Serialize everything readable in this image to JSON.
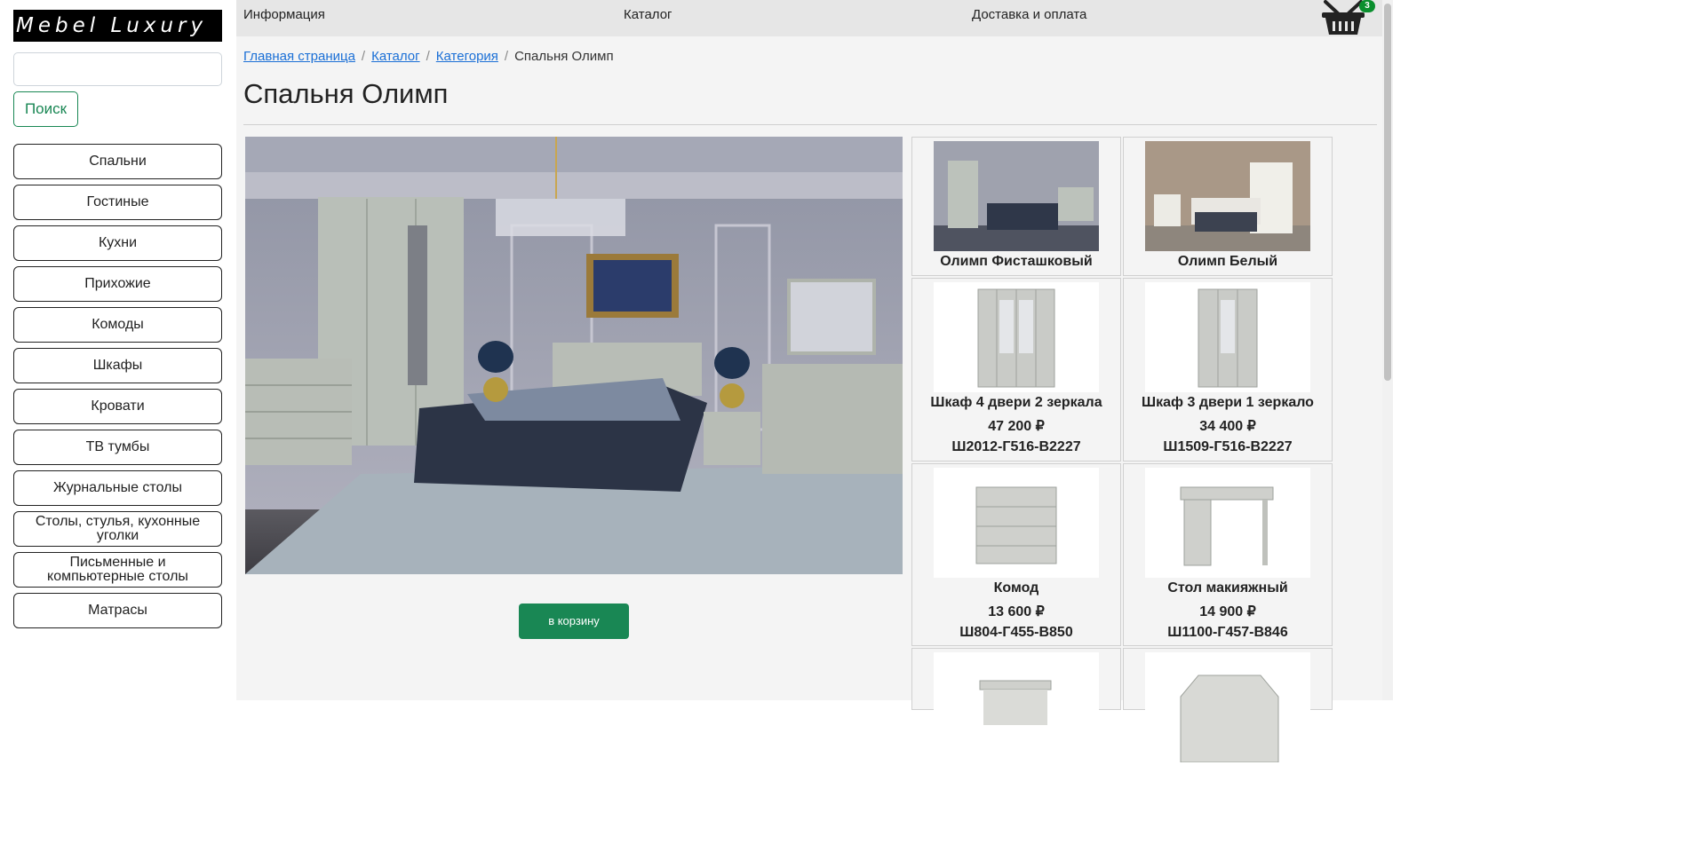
{
  "brand": {
    "logo_text": "Mebel Luxury"
  },
  "search": {
    "placeholder": "",
    "value": "",
    "button_label": "Поиск"
  },
  "categories": [
    "Спальни",
    "Гостиные",
    "Кухни",
    "Прихожие",
    "Комоды",
    "Шкафы",
    "Кровати",
    "ТВ тумбы",
    "Журнальные столы",
    "Столы, стулья, кухонные уголки",
    "Письменные и компьютерные столы",
    "Матрасы"
  ],
  "nav": {
    "info": "Информация",
    "catalog": "Каталог",
    "delivery": "Доставка и оплата",
    "cart_count": "3"
  },
  "breadcrumb": {
    "home": "Главная страница",
    "catalog": "Каталог",
    "category": "Категория",
    "current": "Спальня Олимп"
  },
  "page": {
    "title": "Спальня Олимп",
    "add_to_cart": "в корзину"
  },
  "products": [
    {
      "name": "Олимп Фисташковый",
      "price": "",
      "dims": ""
    },
    {
      "name": "Олимп Белый",
      "price": "",
      "dims": ""
    },
    {
      "name": "Шкаф 4 двери 2 зеркала",
      "price": "47 200 ₽",
      "dims": "Ш2012-Г516-В2227"
    },
    {
      "name": "Шкаф 3 двери 1 зеркало",
      "price": "34 400 ₽",
      "dims": "Ш1509-Г516-В2227"
    },
    {
      "name": "Комод",
      "price": "13 600 ₽",
      "dims": "Ш804-Г455-В850"
    },
    {
      "name": "Стол макияжный",
      "price": "14 900 ₽",
      "dims": "Ш1100-Г457-В846"
    },
    {
      "name": "",
      "price": "",
      "dims": ""
    },
    {
      "name": "",
      "price": "",
      "dims": ""
    }
  ],
  "colors": {
    "accent_green": "#198754",
    "link_blue": "#1a6fd6",
    "badge_green": "#0a8f2e"
  },
  "icons": {
    "cart": "shopping-basket-icon"
  }
}
